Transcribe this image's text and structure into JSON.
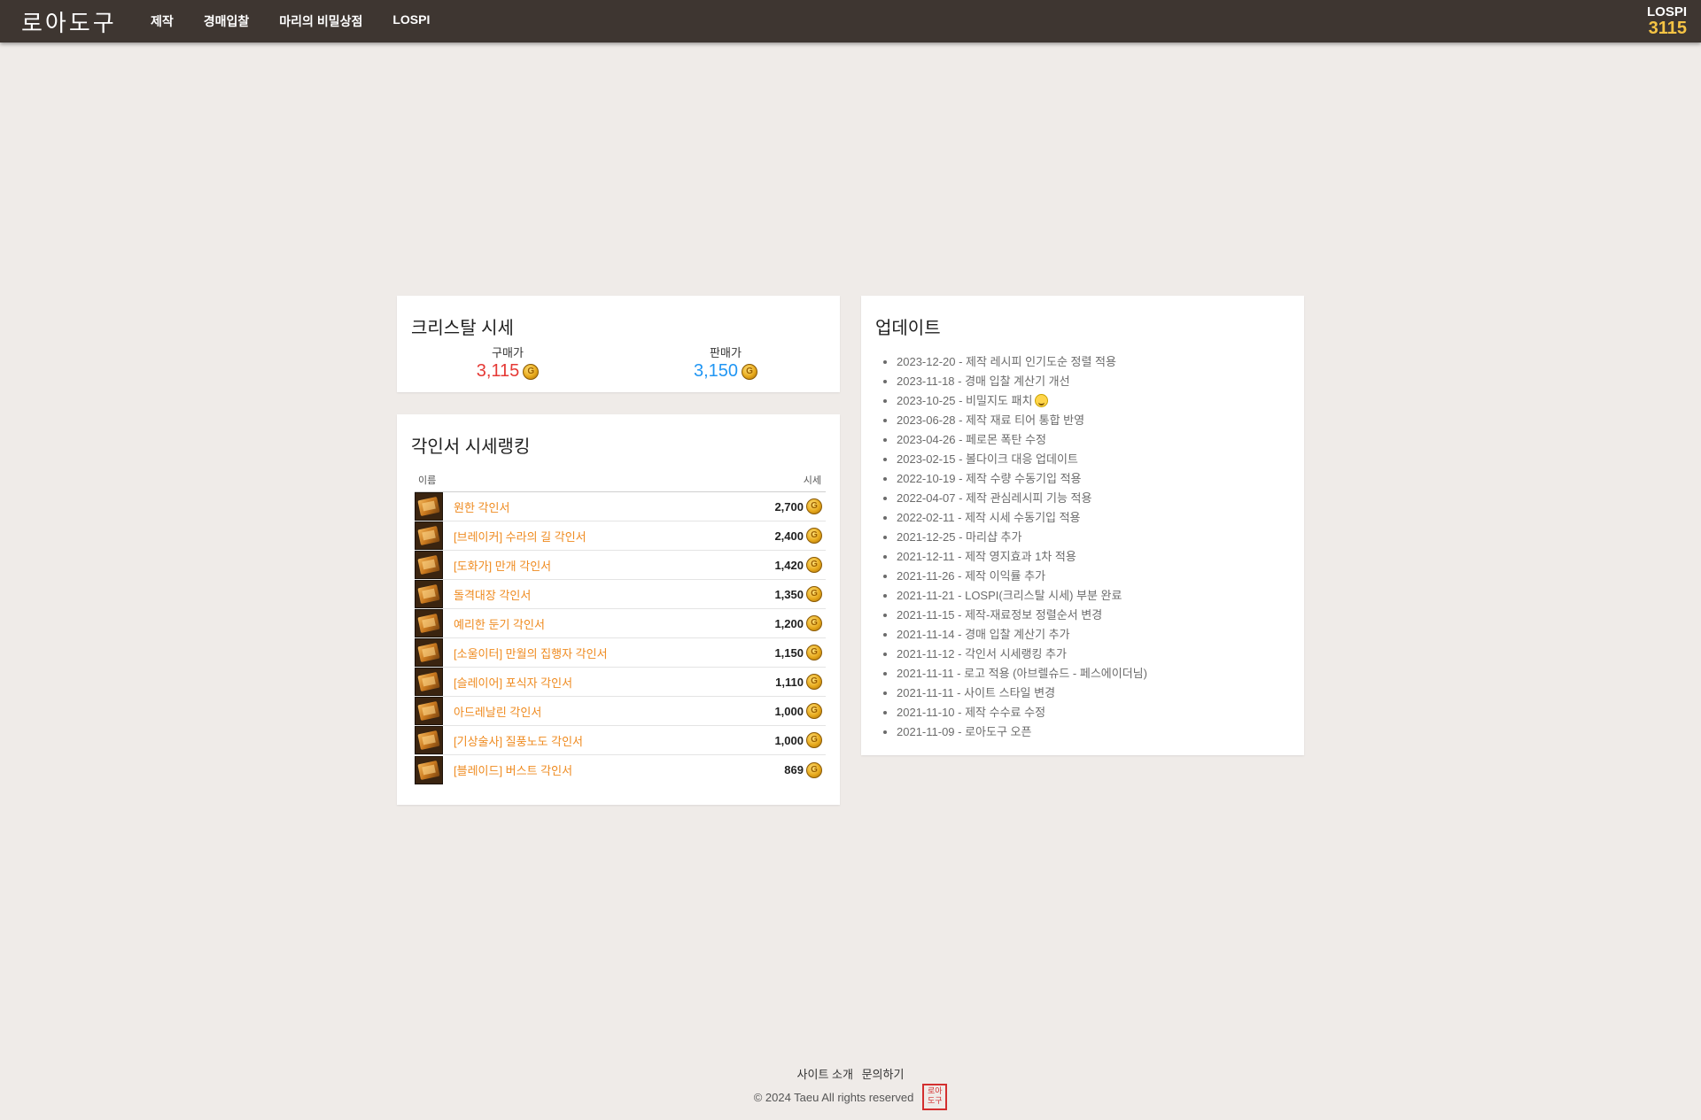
{
  "header": {
    "logo": "로아도구",
    "nav": [
      "제작",
      "경매입찰",
      "마리의 비밀상점",
      "LOSPI"
    ],
    "lospi_label": "LOSPI",
    "lospi_value": "3115"
  },
  "crystal": {
    "title": "크리스탈 시세",
    "buy_label": "구매가",
    "buy_value": "3,115",
    "sell_label": "판매가",
    "sell_value": "3,150"
  },
  "ranking": {
    "title": "각인서 시세랭킹",
    "col_name": "이름",
    "col_price": "시세",
    "items": [
      {
        "name": "원한 각인서",
        "price": "2,700"
      },
      {
        "name": "[브레이커] 수라의 길 각인서",
        "price": "2,400"
      },
      {
        "name": "[도화가] 만개 각인서",
        "price": "1,420"
      },
      {
        "name": "돌격대장 각인서",
        "price": "1,350"
      },
      {
        "name": "예리한 둔기 각인서",
        "price": "1,200"
      },
      {
        "name": "[소울이터] 만월의 집행자 각인서",
        "price": "1,150"
      },
      {
        "name": "[슬레이어] 포식자 각인서",
        "price": "1,110"
      },
      {
        "name": "아드레날린 각인서",
        "price": "1,000"
      },
      {
        "name": "[기상술사] 질풍노도 각인서",
        "price": "1,000"
      },
      {
        "name": "[블레이드] 버스트 각인서",
        "price": "869"
      }
    ]
  },
  "updates": {
    "title": "업데이트",
    "items": [
      "2023-12-20 - 제작 레시피 인기도순 정렬 적용",
      "2023-11-18 - 경매 입찰 계산기 개선",
      "2023-10-25 - 비밀지도 패치",
      "2023-06-28 - 제작 재료 티어 통합 반영",
      "2023-04-26 - 페로몬 폭탄 수정",
      "2023-02-15 - 볼다이크 대응 업데이트",
      "2022-10-19 - 제작 수량 수동기입 적용",
      "2022-04-07 - 제작 관심레시피 기능 적용",
      "2022-02-11 - 제작 시세 수동기입 적용",
      "2021-12-25 - 마리샵 추가",
      "2021-12-11 - 제작 영지효과 1차 적용",
      "2021-11-26 - 제작 이익률 추가",
      "2021-11-21 - LOSPI(크리스탈 시세) 부분 완료",
      "2021-11-15 - 제작-재료정보 정렬순서 변경",
      "2021-11-14 - 경매 입찰 계산기 추가",
      "2021-11-12 - 각인서 시세랭킹 추가",
      "2021-11-11 - 로고 적용 (아브렐슈드 - 페스에이더님)",
      "2021-11-11 - 사이트 스타일 변경",
      "2021-11-10 - 제작 수수료 수정",
      "2021-11-09 - 로아도구 오픈"
    ]
  },
  "footer": {
    "about": "사이트 소개",
    "contact": "문의하기",
    "copyright": "© 2024 Taeu All rights reserved",
    "seal_text": "로아도구"
  },
  "colors": {
    "topbar": "#3e3631",
    "background": "#efebe8",
    "buy": "#e53935",
    "sell": "#2196f3",
    "item_link": "#ef8a1e",
    "lospi_value": "#f6c444"
  }
}
